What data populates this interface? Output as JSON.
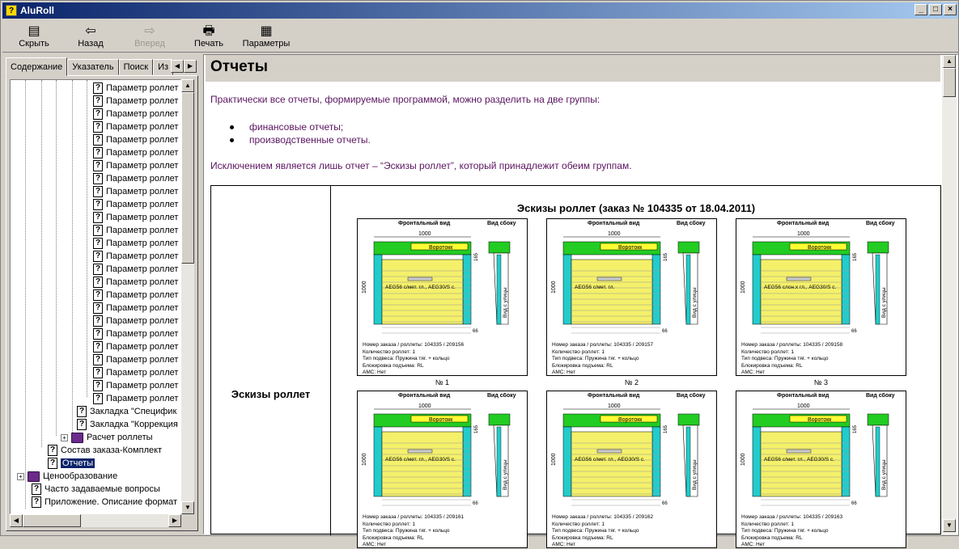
{
  "window": {
    "title": "AluRoll",
    "min": "_",
    "max": "□",
    "close": "×"
  },
  "toolbar": [
    {
      "label": "Скрыть",
      "icon": "hide-icon",
      "glyph": "▤",
      "enabled": true
    },
    {
      "label": "Назад",
      "icon": "back-arrow-icon",
      "glyph": "⇦",
      "enabled": true
    },
    {
      "label": "Вперед",
      "icon": "forward-arrow-icon",
      "glyph": "⇨",
      "enabled": false
    },
    {
      "label": "Печать",
      "icon": "printer-icon",
      "glyph": "🖶",
      "enabled": true
    },
    {
      "label": "Параметры",
      "icon": "options-icon",
      "glyph": "▦",
      "enabled": true
    }
  ],
  "tabs": [
    "Содержание",
    "Указатель",
    "Поиск",
    "Из"
  ],
  "tree": {
    "param_label": "Параметр роллет",
    "items": [
      {
        "label": "Закладка \"Специфик",
        "type": "q",
        "indent": 3
      },
      {
        "label": "Закладка \"Коррекция",
        "type": "q",
        "indent": 3
      },
      {
        "label": "Расчет роллеты",
        "type": "book",
        "indent": 3,
        "expander": "+"
      },
      {
        "label": "Состав заказа-Комплект",
        "type": "q",
        "indent": 2
      },
      {
        "label": "Отчеты",
        "type": "q",
        "indent": 1,
        "selected": true
      },
      {
        "label": "Ценообразование",
        "type": "book",
        "indent": 0,
        "expander": "+"
      },
      {
        "label": "Часто задаваемые вопросы",
        "type": "q",
        "indent": 0
      },
      {
        "label": "Приложение. Описание формат",
        "type": "q",
        "indent": 0
      }
    ]
  },
  "page": {
    "title": "Отчеты",
    "intro": "Практически все отчеты, формируемые программой, можно разделить на две группы:",
    "bullets": [
      "финансовые отчеты;",
      "производственные отчеты."
    ],
    "exception": "Исключением является лишь отчет – “Эскизы роллет”, который принадлежит обеим группам.",
    "table_label": "Эскизы роллет",
    "sketch_title": "Эскизы роллет (заказ № 104335 от 18.04.2011)"
  },
  "sketches": {
    "front_label": "Фронтальный вид",
    "side_label": "Вид сбоку",
    "width": "1000",
    "height": "1000",
    "box": "165",
    "bottom": "66",
    "gate": "Воротокк",
    "street": "Вид с улицы",
    "cards": [
      {
        "num": "№ 1",
        "profile": "AEG56 с/мет. гл., AEG30/S с.",
        "order": "Номер заказа / роллеты: 104335 / 209156"
      },
      {
        "num": "№ 2",
        "profile": "AEG56 с/мет. гл.",
        "order": "Номер заказа / роллеты: 104335 / 209157"
      },
      {
        "num": "№ 3",
        "profile": "AEG56 слон.х гл., AEG30/S с.",
        "order": "Номер заказа / роллеты: 104335 / 209158"
      },
      {
        "num": "",
        "profile": "AEG56 с/мет. гл., AEG30/S с.",
        "order": "Номер заказа / роллеты: 104335 / 209161"
      },
      {
        "num": "",
        "profile": "AEG56 с/мет. гл., AEG30/S с.",
        "order": "Номер заказа / роллеты: 104335 / 209162"
      },
      {
        "num": "",
        "profile": "AEG56 с/мет. гл., AEG30/S с.",
        "order": "Номер заказа / роллеты: 104335 / 209163"
      }
    ],
    "qty": "Количество роллет: 1",
    "hang": "Тип подвеса: Пружина тяг. + кольцо",
    "lock": "Блокировка подъема: RL",
    "ams": "АМС: Нет"
  }
}
